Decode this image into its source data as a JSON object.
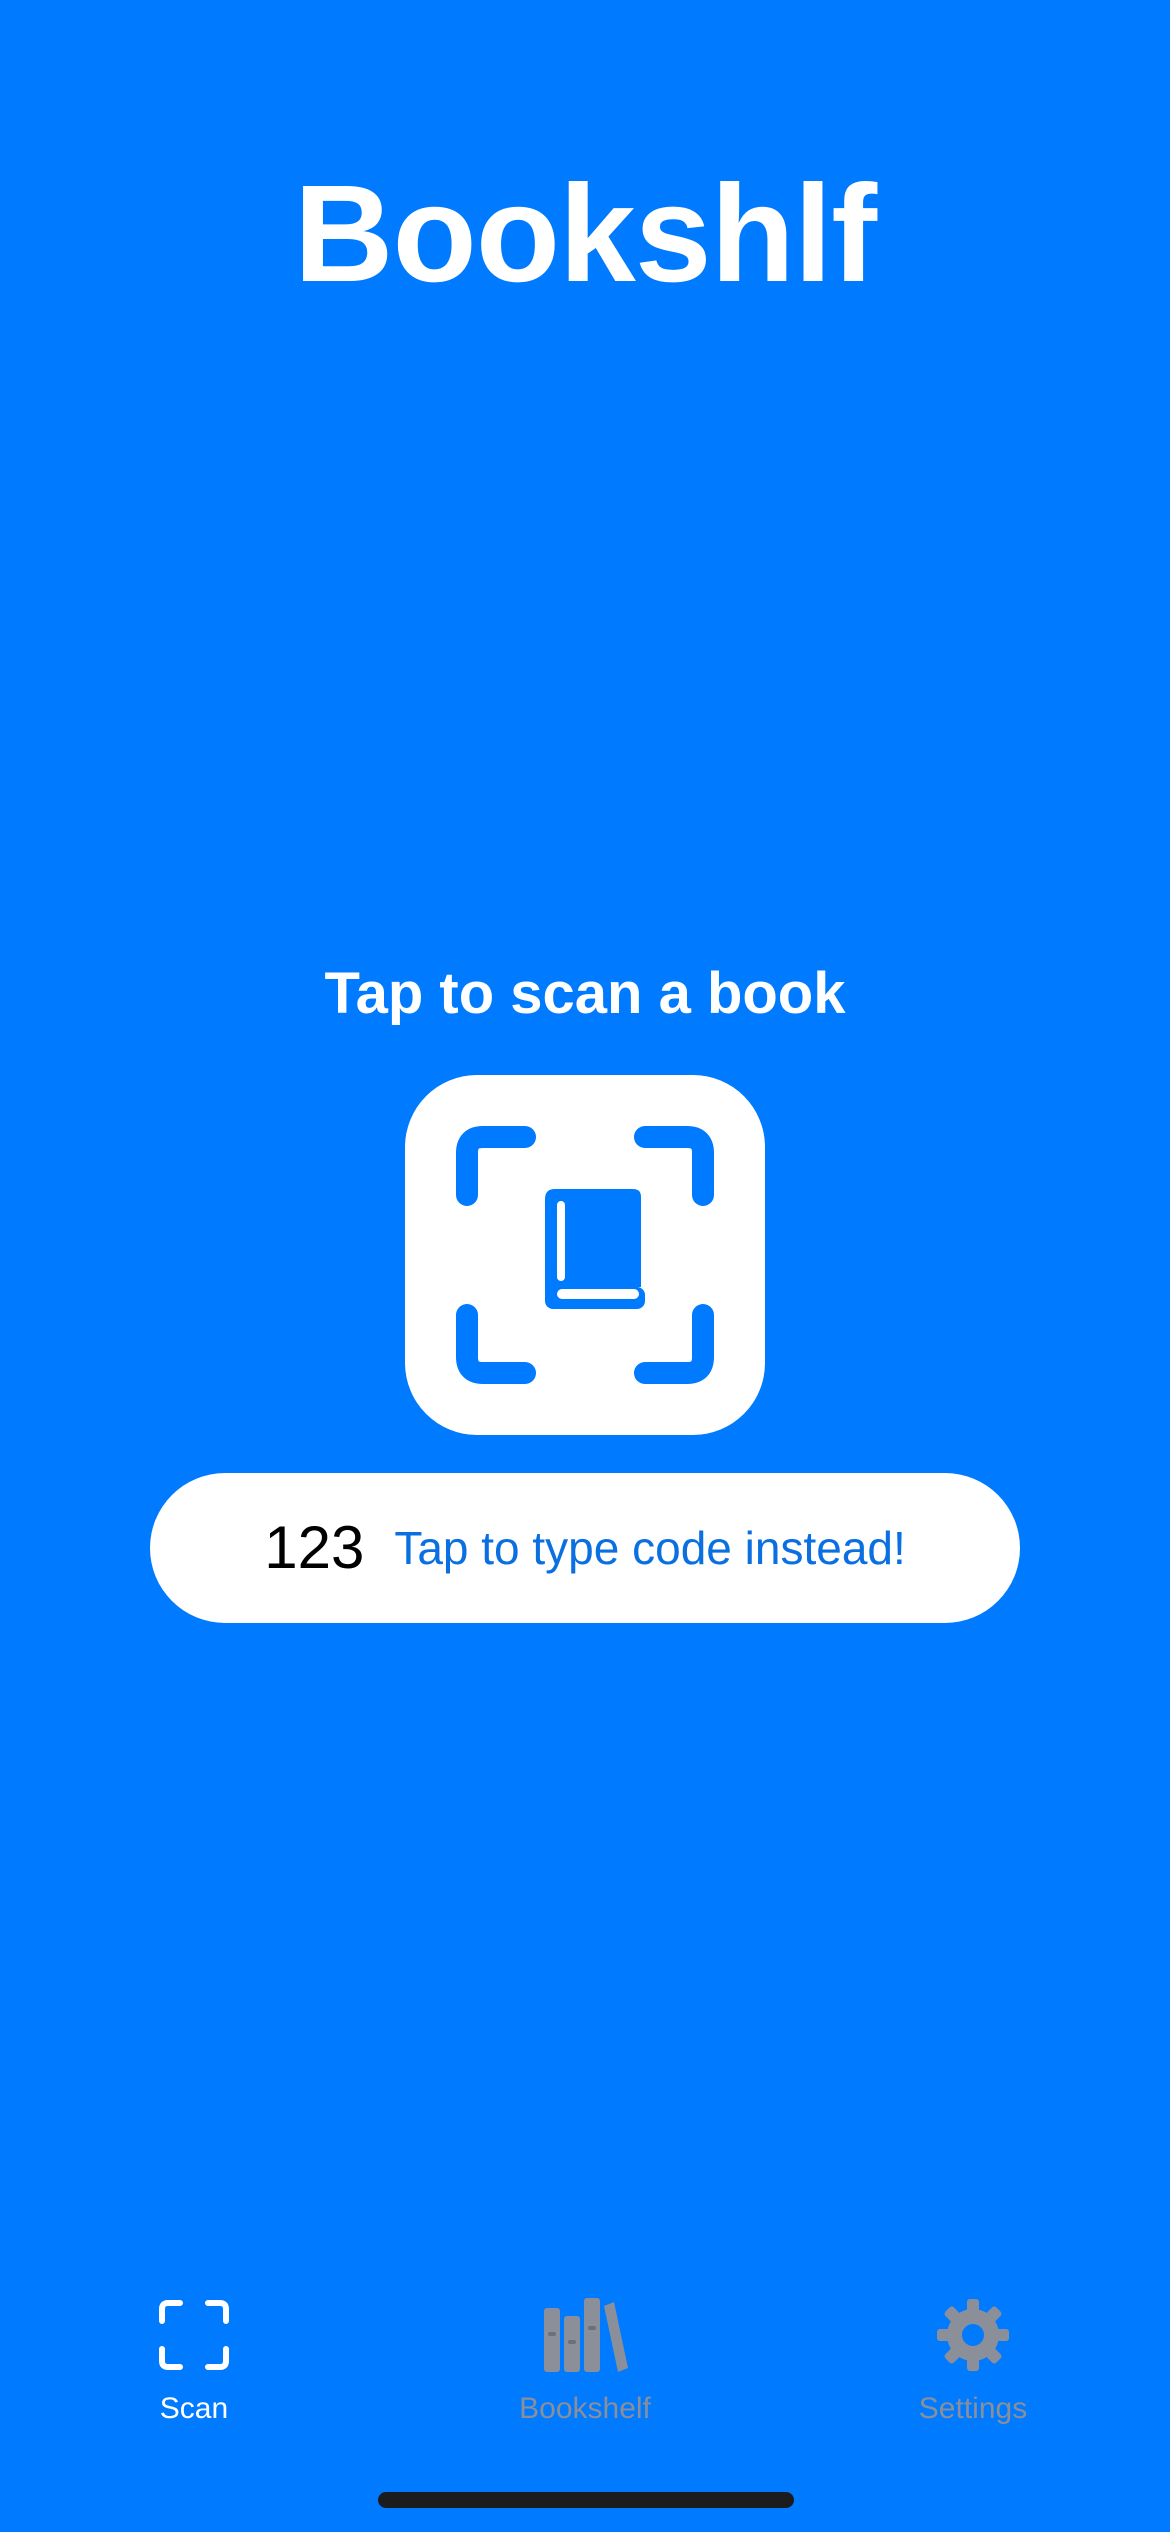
{
  "app": {
    "title": "Bookshlf"
  },
  "scan": {
    "prompt": "Tap to scan a book",
    "button_icon": "book-in-viewfinder-icon"
  },
  "type_code": {
    "icon_text": "123",
    "label": "Tap to type code instead!"
  },
  "tab_bar": {
    "items": [
      {
        "label": "Scan",
        "icon": "viewfinder-icon",
        "active": true
      },
      {
        "label": "Bookshelf",
        "icon": "books-icon",
        "active": false
      },
      {
        "label": "Settings",
        "icon": "gear-icon",
        "active": false
      }
    ]
  },
  "colors": {
    "background": "#007AFF",
    "card": "#FFFFFF",
    "accent_text": "#0A6FE0",
    "tab_inactive": "#8A8F99",
    "home_indicator": "#1C1C1E"
  }
}
